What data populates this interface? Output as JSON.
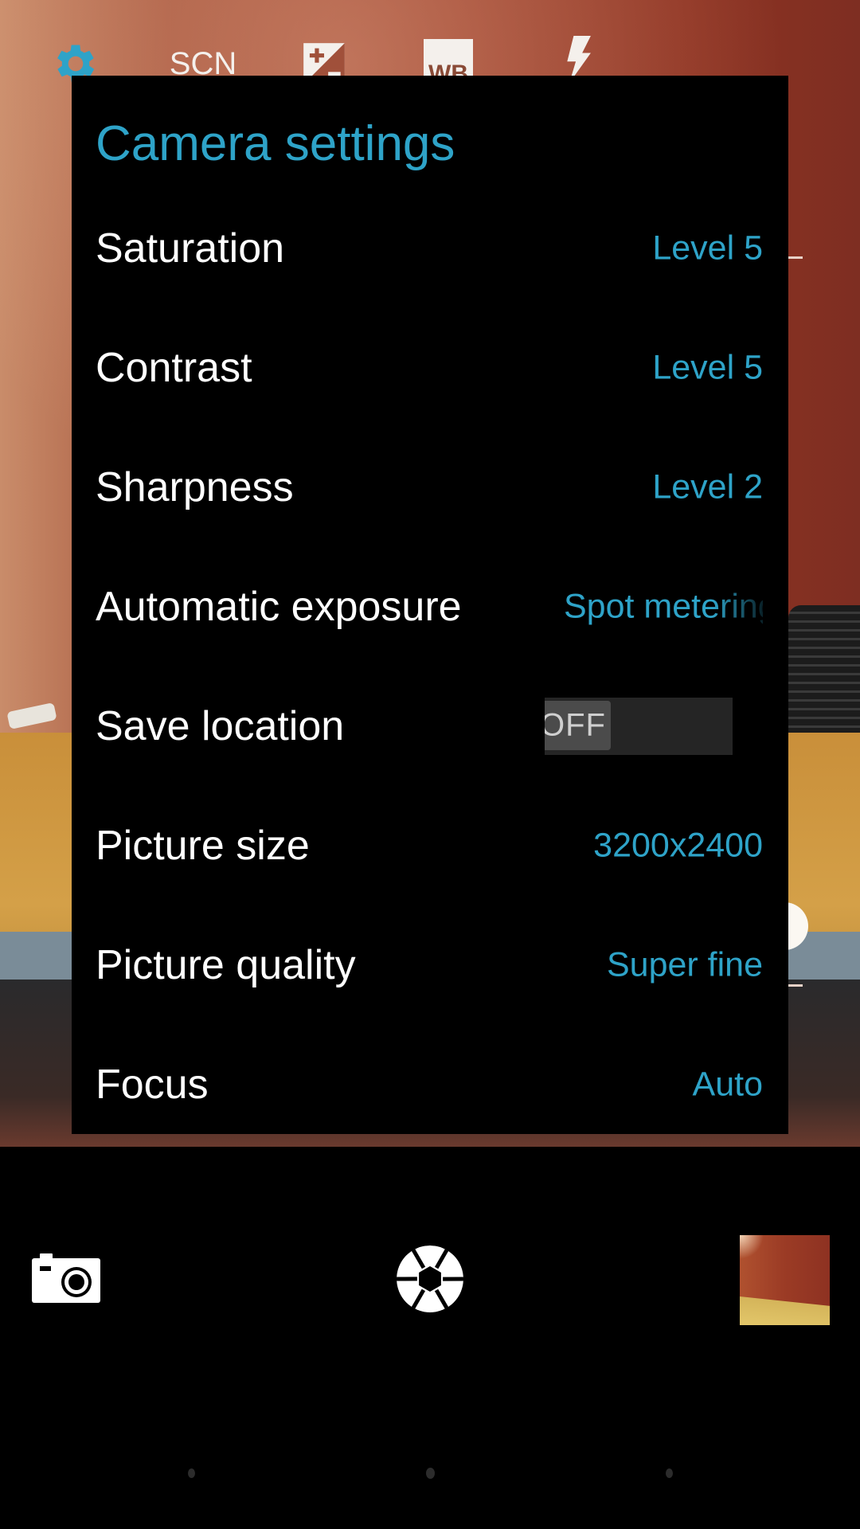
{
  "topbar": {
    "settings_icon": "gear-icon",
    "scene_label": "SCN",
    "exposure_icon": "exposure-compensation-icon",
    "white_balance_label": "WB",
    "flash_icon": "flash-auto-icon"
  },
  "panel": {
    "title": "Camera settings",
    "rows": [
      {
        "label": "Saturation",
        "value": "Level 5"
      },
      {
        "label": "Contrast",
        "value": "Level 5"
      },
      {
        "label": "Sharpness",
        "value": "Level 2"
      },
      {
        "label": "Automatic exposure",
        "value": "Spot metering"
      },
      {
        "label": "Save location",
        "toggle_text": "OFF",
        "toggle_state": "off"
      },
      {
        "label": "Picture size",
        "value": "3200x2400"
      },
      {
        "label": "Picture quality",
        "value": "Super fine"
      },
      {
        "label": "Focus",
        "value": "Auto"
      }
    ]
  },
  "bottombar": {
    "mode_icon": "camera-mode-icon",
    "shutter_icon": "shutter-aperture-icon",
    "thumbnail": "last-photo-thumbnail"
  },
  "colors": {
    "accent": "#2ea3c8",
    "panel_bg": "#000000",
    "label": "#ffffff"
  }
}
